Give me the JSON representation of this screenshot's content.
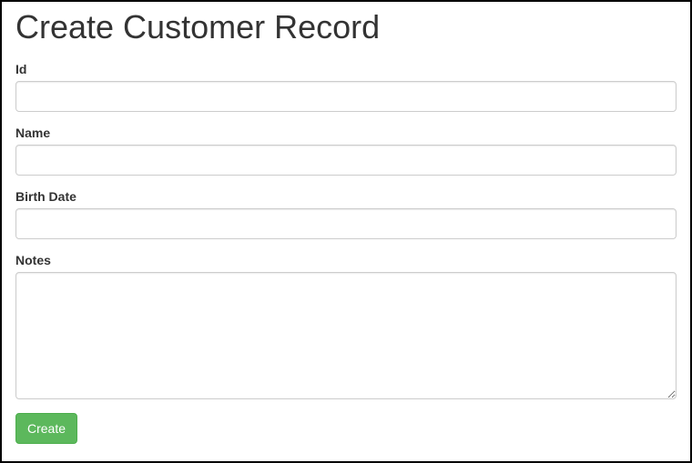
{
  "page": {
    "title": "Create Customer Record"
  },
  "form": {
    "fields": {
      "id": {
        "label": "Id",
        "value": ""
      },
      "name": {
        "label": "Name",
        "value": ""
      },
      "birthDate": {
        "label": "Birth Date",
        "value": ""
      },
      "notes": {
        "label": "Notes",
        "value": ""
      }
    },
    "submit": {
      "label": "Create"
    }
  }
}
